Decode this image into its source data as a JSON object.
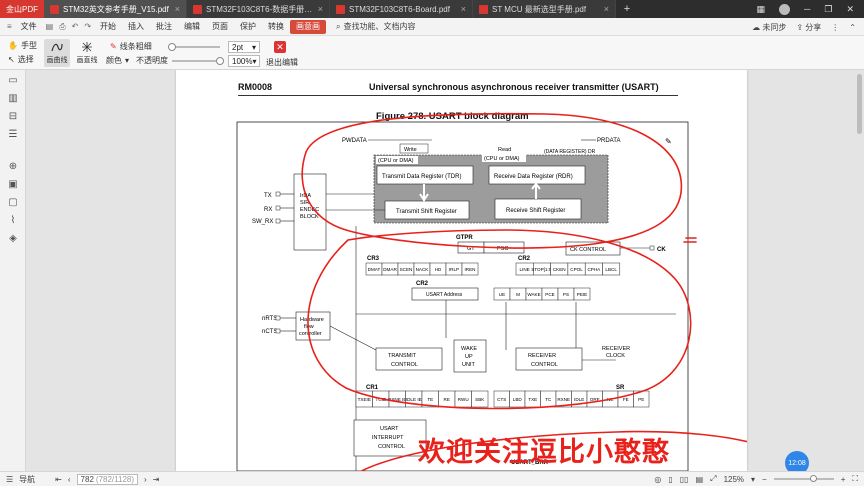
{
  "tabbar": {
    "app_name": "金山PDF",
    "tabs": [
      {
        "label": "STM32英文参考手册_V15.pdf",
        "active": true
      },
      {
        "label": "STM32F103C8T6-数据手册.pdf",
        "active": false
      },
      {
        "label": "STM32F103C8T6-Board.pdf",
        "active": false
      },
      {
        "label": "ST MCU 最新选型手册.pdf",
        "active": false
      }
    ],
    "new_tab": "+",
    "close_glyph": "×"
  },
  "menubar": {
    "file": "文件",
    "items": [
      "开始",
      "插入",
      "批注",
      "编辑",
      "页面",
      "保护",
      "转换"
    ],
    "active_item": "画意画",
    "search": "查找功能、文档内容",
    "sync": "未同步",
    "share": "分享"
  },
  "ribbon": {
    "hand": "手型",
    "select": "选择",
    "pen_curve": "画曲线",
    "pen_line": "画直线",
    "line_width_label": "线条粗细",
    "line_width_value": "2pt",
    "color_label": "颜色",
    "opacity_label": "不透明度",
    "opacity_value": "100%",
    "exit_label": "退出编辑"
  },
  "document": {
    "header_left": "RM0008",
    "header_right": "Universal synchronous asynchronous receiver transmitter (USART)",
    "figure_title": "Figure 278. USART block diagram",
    "labels": {
      "pwdata": "PWDATA",
      "prdata": "PRDATA",
      "write": "Write",
      "read": "Read",
      "data_register": "(DATA REGISTER) DR",
      "cpu_dma_left": "(CPU or DMA)",
      "cpu_dma_right": "(CPU or DMA)",
      "tdr": "Transmit Data Register (TDR)",
      "rdr": "Receive Data Register (RDR)",
      "tsr": "Transmit Shift Register",
      "rsr": "Receive Shift Register",
      "irda": [
        "IrDA",
        "SIR",
        "ENDEC",
        "BLOCK"
      ],
      "tx": "TX",
      "rx": "RX",
      "sw_rx": "SW_RX",
      "gtpr": "GTPR",
      "gt": "GT",
      "psc": "PSC",
      "ck_control": "CK CONTROL",
      "ck": "CK",
      "cr3": "CR3",
      "cr3_bits": [
        "DMAT",
        "DMAR",
        "SCEN",
        "NACK",
        "HD",
        "IRLP",
        "IREN"
      ],
      "cr2": "CR2",
      "cr2_bits": [
        "LINE",
        "STOP[1:0]",
        "CKEN",
        "CPOL",
        "CPHA",
        "LBCL"
      ],
      "cr2b": "CR2",
      "usart_address": "USART Address",
      "cr1_top_bits": [
        "UE",
        "M",
        "WAKE",
        "PCE",
        "PS",
        "PEIE"
      ],
      "nrts": "nRTS",
      "ncts": "nCTS",
      "hw_flow": [
        "Hardware",
        "flow",
        "controller"
      ],
      "transmit_control": [
        "TRANSMIT",
        "CONTROL"
      ],
      "wake_up_unit": [
        "WAKE",
        "UP",
        "UNIT"
      ],
      "receiver_control": [
        "RECEIVER",
        "CONTROL"
      ],
      "receiver_clock": [
        "RECEIVER",
        "CLOCK"
      ],
      "cr1": "CR1",
      "cr1_bits": [
        "TXEIE",
        "TCIE",
        "RXNE IE",
        "IDLE IE",
        "TE",
        "RE",
        "RWU",
        "SBK"
      ],
      "sr": "SR",
      "sr_bits": [
        "CTS",
        "LBD",
        "TXE",
        "TC",
        "RXNE",
        "IDLE",
        "ORE",
        "NE",
        "FE",
        "PE"
      ],
      "usart_interrupt": [
        "USART",
        "INTERRUPT",
        "CONTROL"
      ],
      "usart_brr": "USART_BRR"
    }
  },
  "overlay_text": "欢迎关注逗比小憨憨",
  "clock_badge": "12:08",
  "statusbar": {
    "nav_label": "导航",
    "page_value": "782",
    "page_total": "(782/1128)",
    "zoom": "125%"
  },
  "colors": {
    "accent": "#d64a3a",
    "annotation": "#e8211b",
    "tabbar": "#2d2d2d"
  }
}
